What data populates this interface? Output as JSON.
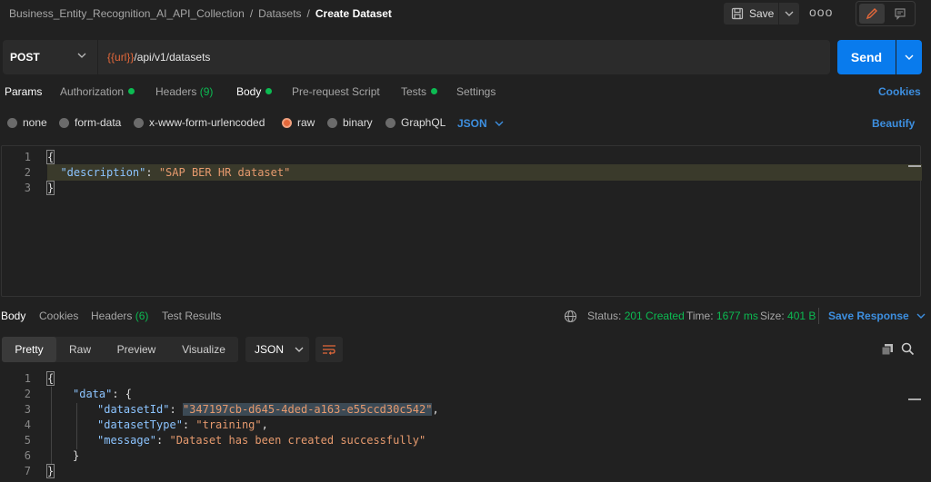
{
  "breadcrumb": {
    "collection": "Business_Entity_Recognition_AI_API_Collection",
    "folder": "Datasets",
    "current": "Create Dataset",
    "separator": "/"
  },
  "toolbar": {
    "save_label": "Save",
    "more_label": "ooo"
  },
  "request": {
    "method": "POST",
    "url_var": "{{url}}",
    "url_path": "/api/v1/datasets",
    "send_label": "Send"
  },
  "request_tabs": {
    "params": "Params",
    "authorization": "Authorization",
    "headers": "Headers",
    "headers_count": "(9)",
    "body": "Body",
    "prerequest": "Pre-request Script",
    "tests": "Tests",
    "settings": "Settings",
    "cookies": "Cookies"
  },
  "body_types": {
    "none": "none",
    "form_data": "form-data",
    "urlencoded": "x-www-form-urlencoded",
    "raw": "raw",
    "binary": "binary",
    "graphql": "GraphQL",
    "format": "JSON",
    "beautify": "Beautify",
    "selected": "raw"
  },
  "request_body": {
    "line_numbers": [
      "1",
      "2",
      "3"
    ],
    "open": "{",
    "key": "\"description\"",
    "colon": ": ",
    "value": "\"SAP BER HR dataset\"",
    "close": "}"
  },
  "response_tabs": {
    "body": "Body",
    "cookies": "Cookies",
    "headers": "Headers",
    "headers_count": "(6)",
    "test_results": "Test Results",
    "status_label": "Status:",
    "status_value": "201 Created",
    "time_label": "Time:",
    "time_value": "1677 ms",
    "size_label": "Size:",
    "size_value": "401 B",
    "save_response": "Save Response"
  },
  "response_view": {
    "pretty": "Pretty",
    "raw": "Raw",
    "preview": "Preview",
    "visualize": "Visualize",
    "format": "JSON"
  },
  "response_body": {
    "line_numbers": [
      "1",
      "2",
      "3",
      "4",
      "5",
      "6",
      "7"
    ],
    "l1": "{",
    "l2_key": "\"data\"",
    "l2_rest": ": {",
    "l3_key": "\"datasetId\"",
    "l3_colon": ": ",
    "l3_val": "\"347197cb-d645-4ded-a163-e55ccd30c542\"",
    "l3_comma": ",",
    "l4_key": "\"datasetType\"",
    "l4_colon": ": ",
    "l4_val": "\"training\"",
    "l4_comma": ",",
    "l5_key": "\"message\"",
    "l5_colon": ": ",
    "l5_val": "\"Dataset has been created successfully\"",
    "l6": "}",
    "l7": "}"
  },
  "colors": {
    "accent": "#097bed",
    "link": "#3d8fe0",
    "success": "#0cbb52",
    "variable": "#e4683a",
    "string": "#e69a6e",
    "key": "#8cc4ff"
  }
}
